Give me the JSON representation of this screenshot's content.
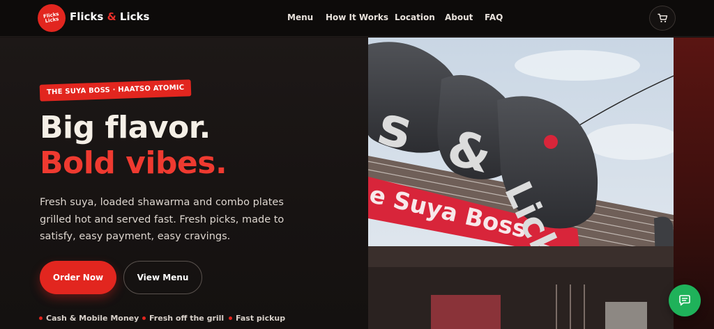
{
  "brand": {
    "logo_text": "Flicks Licks",
    "name_part1": "Flicks",
    "amp": "&",
    "name_part2": "Licks"
  },
  "nav": {
    "items": [
      {
        "label": "Menu"
      },
      {
        "label": "How It Works"
      },
      {
        "label": "Location"
      },
      {
        "label": "About"
      },
      {
        "label": "FAQ"
      }
    ],
    "cart_icon": "cart-icon"
  },
  "hero": {
    "tag": "THE SUYA BOSS · HAATSO ATOMIC",
    "headline_1": "Big flavor.",
    "headline_2": "Bold vibes.",
    "description": "Fresh suya, loaded shawarma and combo plates grilled hot and served fast. Fresh picks, made to satisfy, easy payment, easy cravings.",
    "order_button": "Order Now",
    "view_button": "View Menu",
    "features": [
      {
        "label": "Cash & Mobile Money"
      },
      {
        "label": "Fresh off the grill"
      },
      {
        "label": "Fast pickup"
      }
    ]
  },
  "photo": {
    "sign_word_1": "s",
    "sign_word_2": "&",
    "sign_word_3": "Licks",
    "banner_text": "e Suya Boss"
  },
  "chat": {
    "icon": "chat-icon"
  },
  "colors": {
    "accent": "#e2261f",
    "background": "#161211",
    "header": "#0d0b0a",
    "chat": "#1fb25a"
  }
}
